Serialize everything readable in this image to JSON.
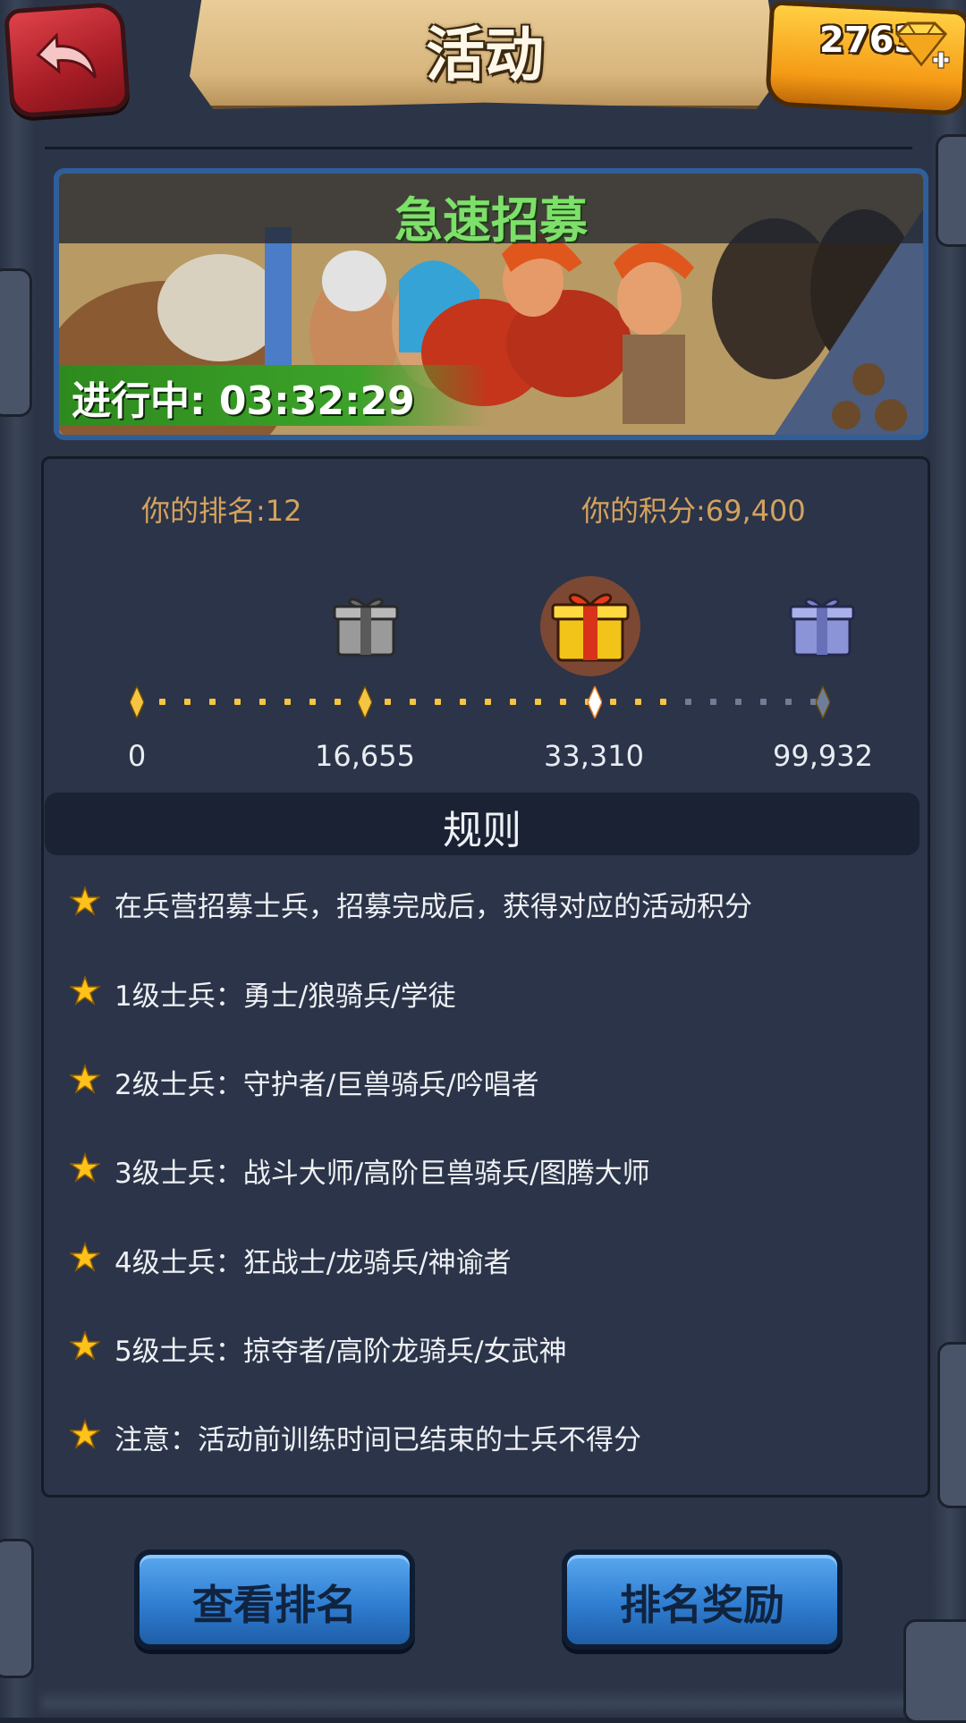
{
  "header": {
    "title": "活动",
    "gems": "2763"
  },
  "event": {
    "name": "急速招募",
    "status": "进行中: 03:32:29"
  },
  "rank": {
    "rank_label": "你的排名:",
    "rank_value": "12",
    "score_label": "你的积分:",
    "score_value": "69,400"
  },
  "milestones": [
    {
      "label": "0",
      "fraction": 0.0
    },
    {
      "label": "16,655",
      "fraction": 0.333
    },
    {
      "label": "33,310",
      "fraction": 0.667
    },
    {
      "label": "99,932",
      "fraction": 1.0
    }
  ],
  "progress_fraction": 0.8,
  "rules": {
    "title": "规则",
    "items": [
      "在兵营招募士兵，招募完成后，获得对应的活动积分",
      "1级士兵：勇士/狼骑兵/学徒",
      "2级士兵：守护者/巨兽骑兵/吟唱者",
      "3级士兵：战斗大师/高阶巨兽骑兵/图腾大师",
      "4级士兵：狂战士/龙骑兵/神谕者",
      "5级士兵：掠夺者/高阶龙骑兵/女武神",
      "注意：活动前训练时间已结束的士兵不得分"
    ]
  },
  "buttons": {
    "view_rank": "查看排名",
    "rank_reward": "排名奖励"
  },
  "colors": {
    "accent_gold": "#d4a25e",
    "event_green": "#7de06a",
    "button_blue": "#2f7ed2",
    "progress_done": "#f5c542",
    "progress_todo": "#6f7d98"
  }
}
